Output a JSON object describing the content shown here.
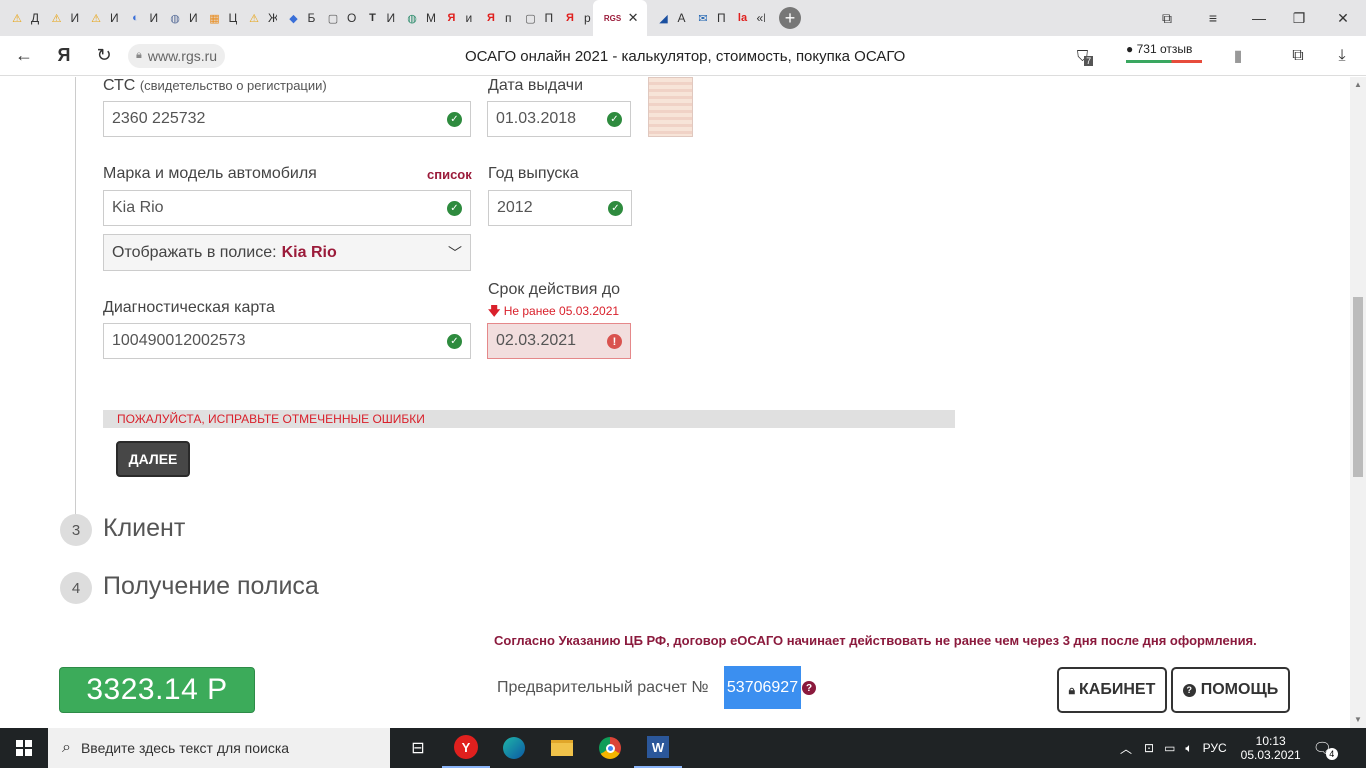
{
  "browser": {
    "tabs": [
      {
        "label": "Д",
        "icon": "yandex-alert-icon",
        "glyph": "⚠",
        "color": "#e8a20e"
      },
      {
        "label": "И",
        "icon": "yandex-alert-icon",
        "glyph": "⚠",
        "color": "#e8a20e"
      },
      {
        "label": "И",
        "icon": "yandex-alert-icon",
        "glyph": "⚠",
        "color": "#e8a20e"
      },
      {
        "label": "И",
        "icon": "globe-icon",
        "glyph": "◐",
        "color": "#3a6fd8"
      },
      {
        "label": "И",
        "icon": "globe-icon",
        "glyph": "◍",
        "color": "#5a6f9a"
      },
      {
        "label": "Ц",
        "icon": "grid-icon",
        "glyph": "▦",
        "color": "#e88a1a"
      },
      {
        "label": "Ж",
        "icon": "yandex-alert-icon",
        "glyph": "⚠",
        "color": "#e8a20e"
      },
      {
        "label": "Б",
        "icon": "shield-icon",
        "glyph": "◆",
        "color": "#3a6fd8"
      },
      {
        "label": "О",
        "icon": "document-icon",
        "glyph": "▢",
        "color": "#555555"
      },
      {
        "label": "И",
        "icon": "t-logo-icon",
        "glyph": "T",
        "color": "#333333"
      },
      {
        "label": "М",
        "icon": "globe-icon",
        "glyph": "◍",
        "color": "#2a8a6a"
      },
      {
        "label": "и",
        "icon": "yandex-icon",
        "glyph": "Я",
        "color": "#e0201e"
      },
      {
        "label": "п",
        "icon": "yandex-icon",
        "glyph": "Я",
        "color": "#e0201e"
      },
      {
        "label": "П",
        "icon": "document-icon",
        "glyph": "▢",
        "color": "#555555"
      },
      {
        "label": "р",
        "icon": "yandex-icon",
        "glyph": "Я",
        "color": "#e0201e"
      },
      {
        "label": "",
        "icon": "rgs-logo-icon",
        "glyph": "RGS",
        "color": "#9b1b3a",
        "active": true
      },
      {
        "label": "А",
        "icon": "chart-icon",
        "glyph": "◢",
        "color": "#1a4fa0"
      },
      {
        "label": "П",
        "icon": "mail-icon",
        "glyph": "✉",
        "color": "#1a60b0"
      },
      {
        "label": "«I",
        "icon": "la-logo-icon",
        "glyph": "la",
        "color": "#e0201e"
      }
    ],
    "url": "www.rgs.ru",
    "page_title": "ОСАГО онлайн 2021 - калькулятор, стоимость, покупка ОСАГО",
    "reviews": "731 отзыв",
    "protect_count": "7"
  },
  "form": {
    "sts_label": "СТС",
    "sts_sub": "(свидетельство о регистрации)",
    "sts_value": "2360 225732",
    "issue_date_label": "Дата выдачи",
    "issue_date_value": "01.03.2018",
    "make_model_label": "Марка и модель автомобиля",
    "list_link": "список",
    "make_model_value": "Kia Rio",
    "year_label": "Год выпуска",
    "year_value": "2012",
    "display_label": "Отображать в полисе:",
    "display_value": "Kia Rio",
    "diag_label": "Диагностическая карта",
    "diag_value": "100490012002573",
    "valid_until_label": "Срок действия до",
    "valid_until_hint": "Не ранее 05.03.2021",
    "valid_until_value": "02.03.2021",
    "error_banner": "ПОЖАЛУЙСТА, ИСПРАВЬТЕ ОТМЕЧЕННЫЕ ОШИБКИ",
    "next_button": "ДАЛЕЕ"
  },
  "steps": [
    {
      "num": "3",
      "title": "Клиент"
    },
    {
      "num": "4",
      "title": "Получение полиса"
    }
  ],
  "notice": "Согласно Указанию ЦБ РФ, договор еОСАГО начинает действовать не ранее чем через 3 дня после дня оформления.",
  "bottom": {
    "price": "3323.14 Р",
    "calc_label": "Предварительный расчет №",
    "calc_number": "53706927",
    "cabinet_button": "КАБИНЕТ",
    "help_button": "ПОМОЩЬ"
  },
  "taskbar": {
    "search_placeholder": "Введите здесь текст для поиска",
    "language": "РУС",
    "time": "10:13",
    "date": "05.03.2021",
    "notifications": "4"
  },
  "colors": {
    "accent": "#9b1b3a",
    "price_green": "#3cab5a",
    "ok_green": "#2e8b3e",
    "error_red": "#d9202b",
    "highlight_blue": "#3b8ff0"
  }
}
